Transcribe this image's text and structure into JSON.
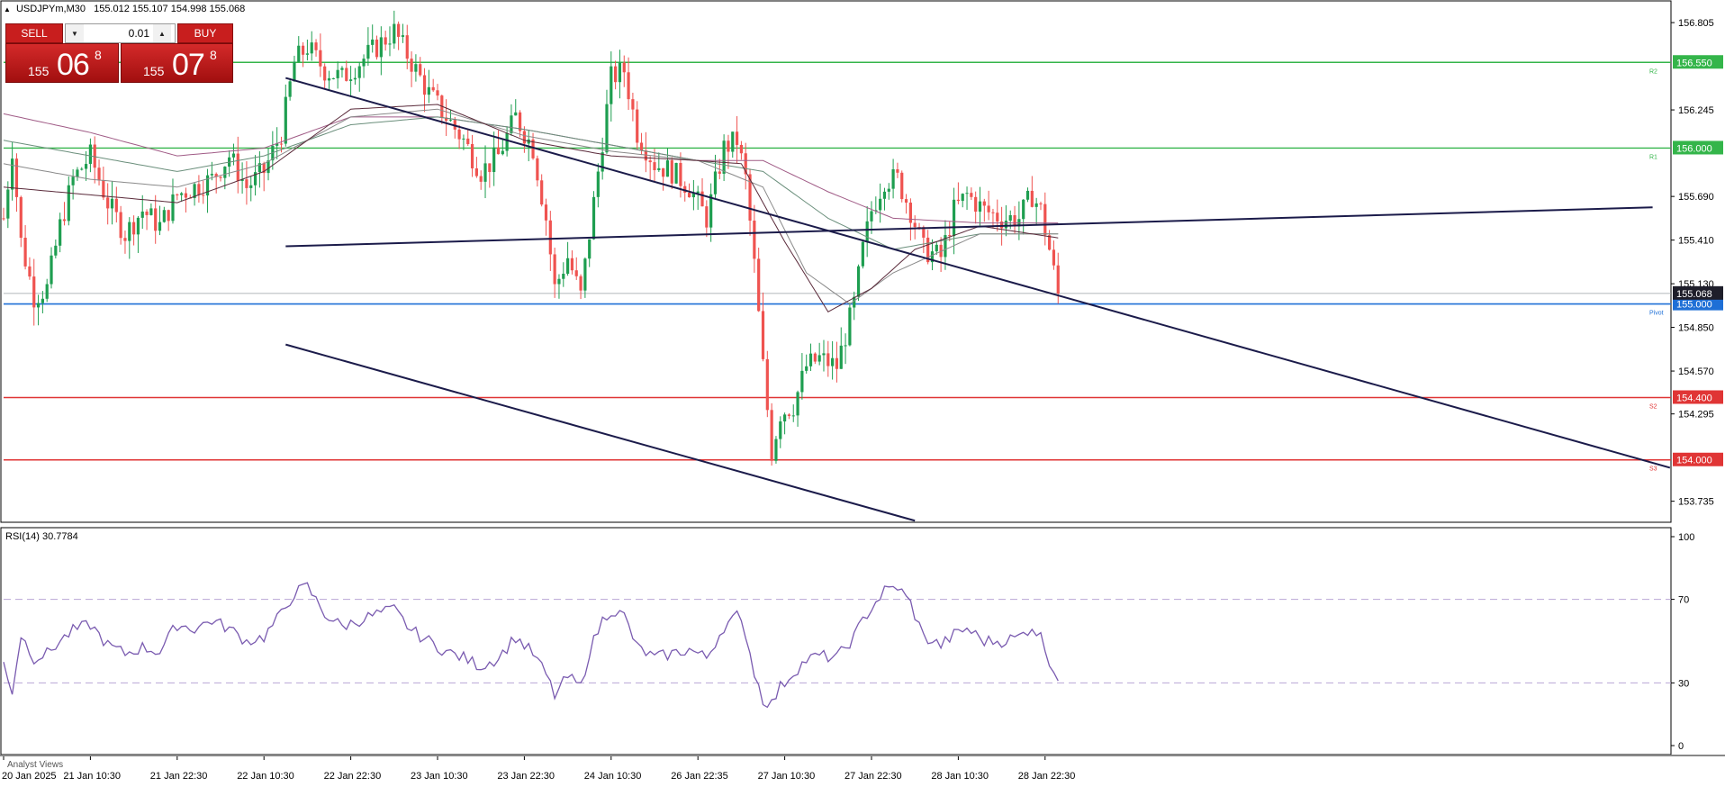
{
  "header": {
    "symbol_text": "USDJPYm,M30",
    "ohlc_text": "155.012 155.107 154.998 155.068",
    "collapse_icon": "triangle-up-icon"
  },
  "trade_panel": {
    "sell_label": "SELL",
    "buy_label": "BUY",
    "lot_value": "0.01",
    "sell_prefix": "155",
    "sell_big": "06",
    "sell_sup": "8",
    "buy_prefix": "155",
    "buy_big": "07",
    "buy_sup": "8",
    "down_icon": "triangle-down-icon",
    "up_icon": "triangle-up-icon"
  },
  "rsi": {
    "label": "RSI(14) 30.7784"
  },
  "footer": {
    "text": "Analyst Views"
  },
  "colors": {
    "bull": "#1e9e50",
    "bear": "#ef5350",
    "grid": "#c8c8c8",
    "resistance": "#34b54a",
    "support": "#e03535",
    "pivot": "#1e6fd6",
    "channel": "#1b1b4a",
    "rsi_line": "#7a5bb0",
    "rsi_level": "#b9a6d6"
  },
  "chart_data": [
    {
      "type": "candlestick",
      "title": "USDJPYm,M30",
      "xlabel": "",
      "ylabel": "",
      "ylim": [
        153.6,
        156.95
      ],
      "y_ticks": [
        "156.805",
        "156.245",
        "155.690",
        "155.410",
        "155.130",
        "154.850",
        "154.570",
        "154.295",
        "153.735"
      ],
      "y_ticks_hidden": [
        "156.525",
        "155.965",
        "154.015"
      ],
      "x_ticks": [
        {
          "idx": 0,
          "label": "20 Jan 2025"
        },
        {
          "idx": 20,
          "label": "21 Jan 10:30"
        },
        {
          "idx": 40,
          "label": "21 Jan 22:30"
        },
        {
          "idx": 60,
          "label": "22 Jan 10:30"
        },
        {
          "idx": 80,
          "label": "22 Jan 22:30"
        },
        {
          "idx": 100,
          "label": "23 Jan 10:30"
        },
        {
          "idx": 120,
          "label": "23 Jan 22:30"
        },
        {
          "idx": 140,
          "label": "24 Jan 10:30"
        },
        {
          "idx": 160,
          "label": "26 Jan 22:35"
        },
        {
          "idx": 180,
          "label": "27 Jan 10:30"
        },
        {
          "idx": 200,
          "label": "27 Jan 22:30"
        },
        {
          "idx": 220,
          "label": "28 Jan 10:30"
        },
        {
          "idx": 240,
          "label": "28 Jan 22:30"
        }
      ],
      "last_price": "155.068",
      "levels": [
        {
          "name": "R2",
          "value": 156.55,
          "label": "156.550",
          "color": "#34b54a"
        },
        {
          "name": "R1",
          "value": 156.0,
          "label": "156.000",
          "color": "#34b54a"
        },
        {
          "name": "Pivot",
          "value": 155.0,
          "label": "155.000",
          "color": "#1e6fd6"
        },
        {
          "name": "S2",
          "value": 154.4,
          "label": "154.400",
          "color": "#e03535"
        },
        {
          "name": "S3",
          "value": 154.0,
          "label": "154.000",
          "color": "#e03535"
        }
      ],
      "channel_lines": [
        {
          "from": [
            65,
            155.37
          ],
          "to": [
            380,
            155.62
          ]
        },
        {
          "from": [
            65,
            156.45
          ],
          "to": [
            384,
            153.95
          ]
        },
        {
          "from": [
            65,
            154.74
          ],
          "to": [
            210,
            153.61
          ]
        }
      ],
      "anchors": [
        [
          0,
          155.55
        ],
        [
          2,
          156.0
        ],
        [
          4,
          155.4
        ],
        [
          7,
          155.05
        ],
        [
          10,
          155.1
        ],
        [
          13,
          155.5
        ],
        [
          16,
          155.8
        ],
        [
          20,
          155.95
        ],
        [
          24,
          155.65
        ],
        [
          28,
          155.45
        ],
        [
          32,
          155.6
        ],
        [
          36,
          155.5
        ],
        [
          40,
          155.7
        ],
        [
          44,
          155.75
        ],
        [
          48,
          155.8
        ],
        [
          52,
          155.95
        ],
        [
          56,
          155.75
        ],
        [
          60,
          155.85
        ],
        [
          64,
          156.1
        ],
        [
          67,
          156.55
        ],
        [
          70,
          156.65
        ],
        [
          74,
          156.5
        ],
        [
          78,
          156.45
        ],
        [
          82,
          156.55
        ],
        [
          86,
          156.65
        ],
        [
          90,
          156.75
        ],
        [
          94,
          156.55
        ],
        [
          98,
          156.35
        ],
        [
          102,
          156.2
        ],
        [
          106,
          156.05
        ],
        [
          110,
          155.85
        ],
        [
          114,
          155.95
        ],
        [
          118,
          156.2
        ],
        [
          122,
          156.0
        ],
        [
          125,
          155.55
        ],
        [
          127,
          155.1
        ],
        [
          130,
          155.3
        ],
        [
          133,
          155.05
        ],
        [
          135,
          155.45
        ],
        [
          138,
          156.05
        ],
        [
          140,
          156.45
        ],
        [
          143,
          156.5
        ],
        [
          146,
          156.1
        ],
        [
          150,
          155.9
        ],
        [
          154,
          155.85
        ],
        [
          158,
          155.75
        ],
        [
          162,
          155.55
        ],
        [
          166,
          156.0
        ],
        [
          169,
          156.05
        ],
        [
          171,
          155.8
        ],
        [
          173,
          155.25
        ],
        [
          175,
          154.6
        ],
        [
          177,
          154.05
        ],
        [
          179,
          154.3
        ],
        [
          182,
          154.35
        ],
        [
          185,
          154.6
        ],
        [
          188,
          154.65
        ],
        [
          192,
          154.6
        ],
        [
          196,
          155.0
        ],
        [
          198,
          155.35
        ],
        [
          200,
          155.6
        ],
        [
          203,
          155.8
        ],
        [
          206,
          155.8
        ],
        [
          209,
          155.6
        ],
        [
          212,
          155.35
        ],
        [
          216,
          155.3
        ],
        [
          219,
          155.6
        ],
        [
          222,
          155.7
        ],
        [
          226,
          155.6
        ],
        [
          230,
          155.55
        ],
        [
          234,
          155.55
        ],
        [
          237,
          155.7
        ],
        [
          239,
          155.6
        ],
        [
          241,
          155.35
        ],
        [
          243,
          155.06
        ]
      ],
      "ma_series": [
        {
          "color": "#a05b86",
          "anchors": [
            [
              0,
              156.22
            ],
            [
              20,
              156.1
            ],
            [
              40,
              155.95
            ],
            [
              60,
              156.0
            ],
            [
              80,
              156.2
            ],
            [
              100,
              156.2
            ],
            [
              120,
              156.12
            ],
            [
              140,
              156.02
            ],
            [
              160,
              155.92
            ],
            [
              175,
              155.92
            ],
            [
              190,
              155.72
            ],
            [
              205,
              155.55
            ],
            [
              225,
              155.52
            ],
            [
              244,
              155.52
            ]
          ]
        },
        {
          "color": "#6b8f7c",
          "anchors": [
            [
              0,
              156.05
            ],
            [
              20,
              155.95
            ],
            [
              40,
              155.85
            ],
            [
              60,
              155.95
            ],
            [
              80,
              156.15
            ],
            [
              100,
              156.2
            ],
            [
              120,
              156.12
            ],
            [
              140,
              156.02
            ],
            [
              160,
              155.92
            ],
            [
              175,
              155.85
            ],
            [
              190,
              155.55
            ],
            [
              205,
              155.35
            ],
            [
              225,
              155.45
            ],
            [
              244,
              155.45
            ]
          ]
        },
        {
          "color": "#8a8a8a",
          "anchors": [
            [
              0,
              155.9
            ],
            [
              20,
              155.8
            ],
            [
              40,
              155.75
            ],
            [
              60,
              155.9
            ],
            [
              80,
              156.2
            ],
            [
              100,
              156.25
            ],
            [
              120,
              156.08
            ],
            [
              140,
              155.98
            ],
            [
              160,
              155.92
            ],
            [
              175,
              155.75
            ],
            [
              185,
              155.2
            ],
            [
              195,
              155.0
            ],
            [
              205,
              155.2
            ],
            [
              225,
              155.45
            ],
            [
              244,
              155.45
            ]
          ]
        },
        {
          "color": "#5a2a3a",
          "anchors": [
            [
              0,
              155.75
            ],
            [
              20,
              155.7
            ],
            [
              40,
              155.65
            ],
            [
              60,
              155.85
            ],
            [
              80,
              156.25
            ],
            [
              100,
              156.28
            ],
            [
              120,
              156.05
            ],
            [
              140,
              155.95
            ],
            [
              160,
              155.92
            ],
            [
              170,
              155.9
            ],
            [
              180,
              155.4
            ],
            [
              190,
              154.95
            ],
            [
              200,
              155.1
            ],
            [
              210,
              155.35
            ],
            [
              225,
              155.5
            ],
            [
              244,
              155.42
            ]
          ]
        }
      ]
    },
    {
      "type": "line",
      "title": "RSI(14) 30.7784",
      "ylim": [
        0,
        100
      ],
      "y_ticks": [
        "100",
        "70",
        "30",
        "0"
      ],
      "levels": [
        70,
        30
      ],
      "series": [
        {
          "anchors": [
            [
              0,
              40
            ],
            [
              2,
              26
            ],
            [
              4,
              53
            ],
            [
              7,
              42
            ],
            [
              10,
              44
            ],
            [
              13,
              50
            ],
            [
              16,
              55
            ],
            [
              20,
              58
            ],
            [
              24,
              48
            ],
            [
              28,
              44
            ],
            [
              32,
              47
            ],
            [
              36,
              45
            ],
            [
              40,
              58
            ],
            [
              44,
              56
            ],
            [
              48,
              60
            ],
            [
              52,
              56
            ],
            [
              56,
              50
            ],
            [
              60,
              52
            ],
            [
              64,
              63
            ],
            [
              67,
              73
            ],
            [
              70,
              76
            ],
            [
              74,
              63
            ],
            [
              78,
              57
            ],
            [
              82,
              60
            ],
            [
              86,
              63
            ],
            [
              90,
              65
            ],
            [
              94,
              55
            ],
            [
              98,
              50
            ],
            [
              102,
              45
            ],
            [
              106,
              42
            ],
            [
              110,
              38
            ],
            [
              114,
              42
            ],
            [
              118,
              52
            ],
            [
              122,
              44
            ],
            [
              125,
              34
            ],
            [
              127,
              24
            ],
            [
              130,
              33
            ],
            [
              133,
              28
            ],
            [
              135,
              45
            ],
            [
              138,
              60
            ],
            [
              140,
              65
            ],
            [
              143,
              62
            ],
            [
              146,
              47
            ],
            [
              150,
              42
            ],
            [
              154,
              44
            ],
            [
              158,
              46
            ],
            [
              162,
              42
            ],
            [
              166,
              57
            ],
            [
              169,
              62
            ],
            [
              171,
              54
            ],
            [
              173,
              35
            ],
            [
              175,
              22
            ],
            [
              177,
              20
            ],
            [
              179,
              28
            ],
            [
              182,
              35
            ],
            [
              185,
              41
            ],
            [
              188,
              43
            ],
            [
              192,
              42
            ],
            [
              196,
              52
            ],
            [
              198,
              60
            ],
            [
              200,
              66
            ],
            [
              203,
              74
            ],
            [
              206,
              76
            ],
            [
              209,
              68
            ],
            [
              212,
              52
            ],
            [
              216,
              48
            ],
            [
              219,
              53
            ],
            [
              222,
              56
            ],
            [
              226,
              50
            ],
            [
              230,
              50
            ],
            [
              234,
              52
            ],
            [
              237,
              57
            ],
            [
              239,
              52
            ],
            [
              241,
              41
            ],
            [
              243,
              31
            ]
          ]
        }
      ]
    }
  ]
}
